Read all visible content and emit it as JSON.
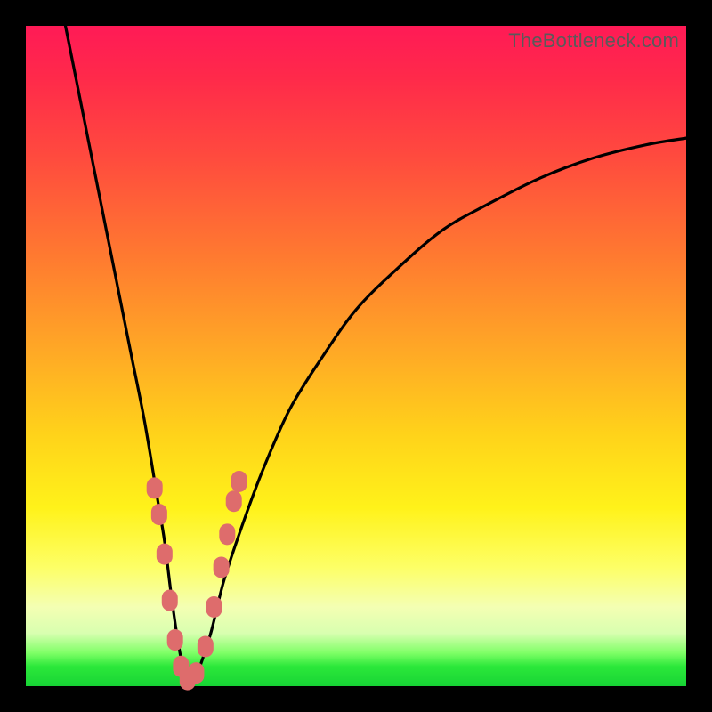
{
  "watermark": "TheBottleneck.com",
  "colors": {
    "frame": "#000000",
    "curve": "#000000",
    "marker": "#de6c6c",
    "gradient_top": "#ff1a56",
    "gradient_bottom": "#17d435"
  },
  "chart_data": {
    "type": "line",
    "title": "",
    "xlabel": "",
    "ylabel": "",
    "xlim": [
      0,
      100
    ],
    "ylim": [
      0,
      100
    ],
    "series": [
      {
        "name": "bottleneck-curve",
        "x": [
          6,
          8,
          10,
          12,
          14,
          16,
          18,
          20,
          21,
          22,
          23,
          24,
          25,
          26,
          28,
          30,
          33,
          36,
          40,
          45,
          50,
          56,
          63,
          70,
          78,
          86,
          94,
          100
        ],
        "y": [
          100,
          90,
          80,
          70,
          60,
          50,
          40,
          28,
          22,
          14,
          7,
          2,
          0,
          2,
          8,
          16,
          25,
          33,
          42,
          50,
          57,
          63,
          69,
          73,
          77,
          80,
          82,
          83
        ]
      }
    ],
    "markers": {
      "name": "highlighted-points",
      "points": [
        {
          "x": 19.5,
          "y": 30
        },
        {
          "x": 20.2,
          "y": 26
        },
        {
          "x": 21.0,
          "y": 20
        },
        {
          "x": 21.8,
          "y": 13
        },
        {
          "x": 22.6,
          "y": 7
        },
        {
          "x": 23.5,
          "y": 3
        },
        {
          "x": 24.5,
          "y": 1
        },
        {
          "x": 25.8,
          "y": 2
        },
        {
          "x": 27.2,
          "y": 6
        },
        {
          "x": 28.5,
          "y": 12
        },
        {
          "x": 29.6,
          "y": 18
        },
        {
          "x": 30.5,
          "y": 23
        },
        {
          "x": 31.5,
          "y": 28
        },
        {
          "x": 32.3,
          "y": 31
        }
      ]
    }
  }
}
